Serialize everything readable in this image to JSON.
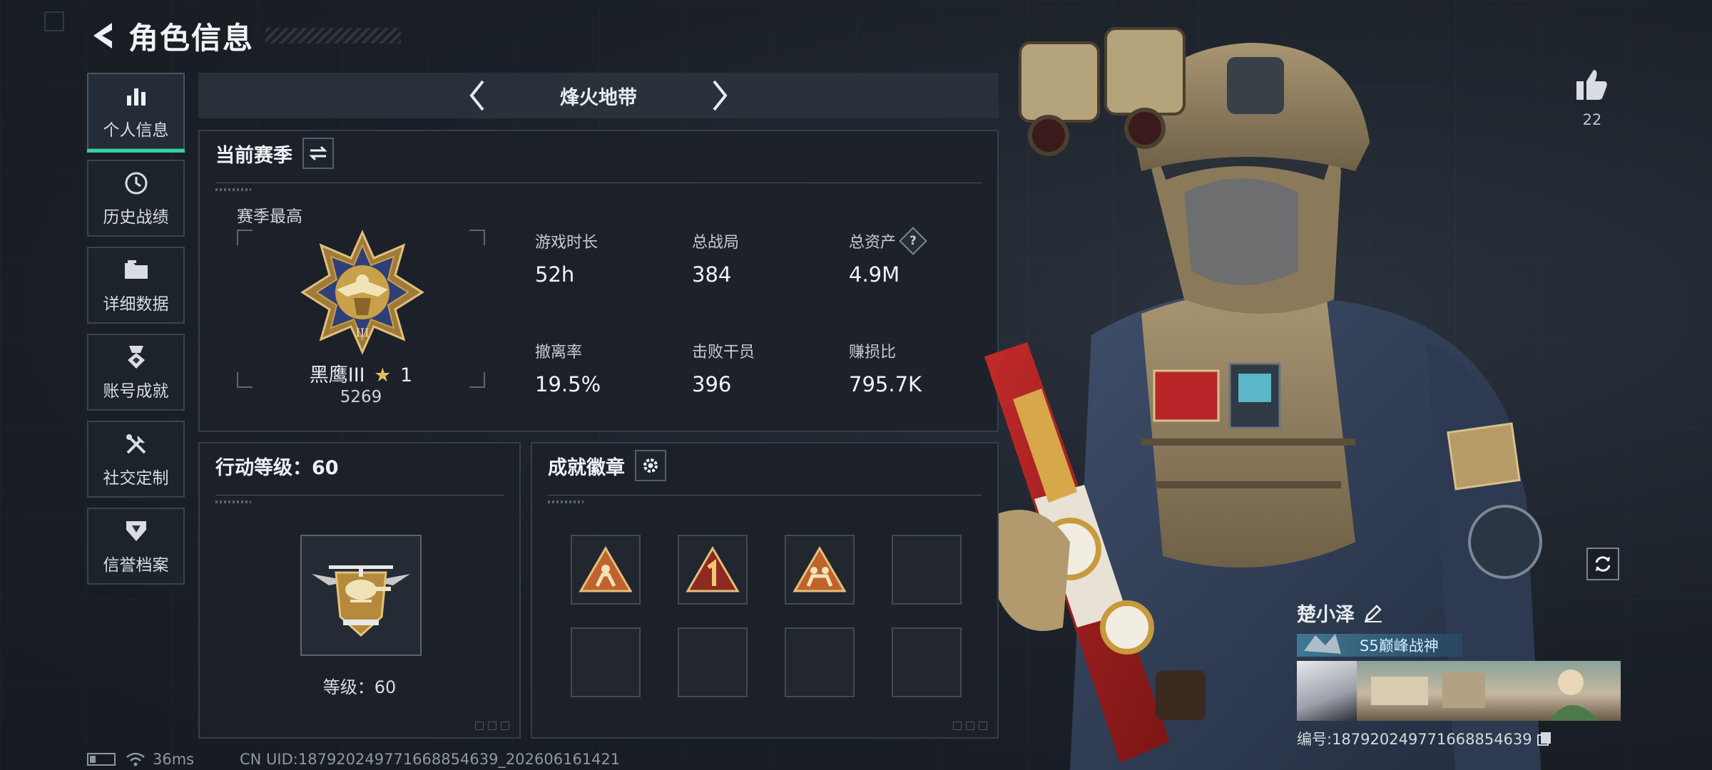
{
  "header": {
    "title": "角色信息"
  },
  "sidebar": {
    "items": [
      {
        "label": "个人信息",
        "icon": "bar-chart-icon",
        "active": true
      },
      {
        "label": "历史战绩",
        "icon": "clock-icon"
      },
      {
        "label": "详细数据",
        "icon": "folder-icon"
      },
      {
        "label": "账号成就",
        "icon": "medal-icon"
      },
      {
        "label": "社交定制",
        "icon": "tools-icon"
      },
      {
        "label": "信誉档案",
        "icon": "shield-icon"
      }
    ]
  },
  "mode": {
    "title": "烽火地带"
  },
  "season": {
    "title": "当前赛季",
    "best_label": "赛季最高",
    "rank_name": "黑鹰III",
    "rank_stars": "1",
    "rank_score": "5269",
    "stats": [
      {
        "label": "游戏时长",
        "value": "52h"
      },
      {
        "label": "总战局",
        "value": "384"
      },
      {
        "label": "总资产",
        "value": "4.9M"
      },
      {
        "label": "撤离率",
        "value": "19.5%"
      },
      {
        "label": "击败干员",
        "value": "396"
      },
      {
        "label": "赚损比",
        "value": "795.7K"
      }
    ],
    "help_glyph": "?"
  },
  "action_level": {
    "title": "行动等级：60",
    "level_text": "等级：60"
  },
  "achievements": {
    "title": "成就徽章"
  },
  "like": {
    "count": "22"
  },
  "player_card": {
    "name": "楚小泽",
    "title_badge": "S5巅峰战神",
    "id_text": "编号:18792024977166885463​9"
  },
  "status_bar": {
    "ping": "36ms",
    "uid": "CN UID:18792024977166885463​9_202606161421"
  },
  "colors": {
    "accent": "#2bd8a0",
    "gold": "#c9a14a"
  }
}
